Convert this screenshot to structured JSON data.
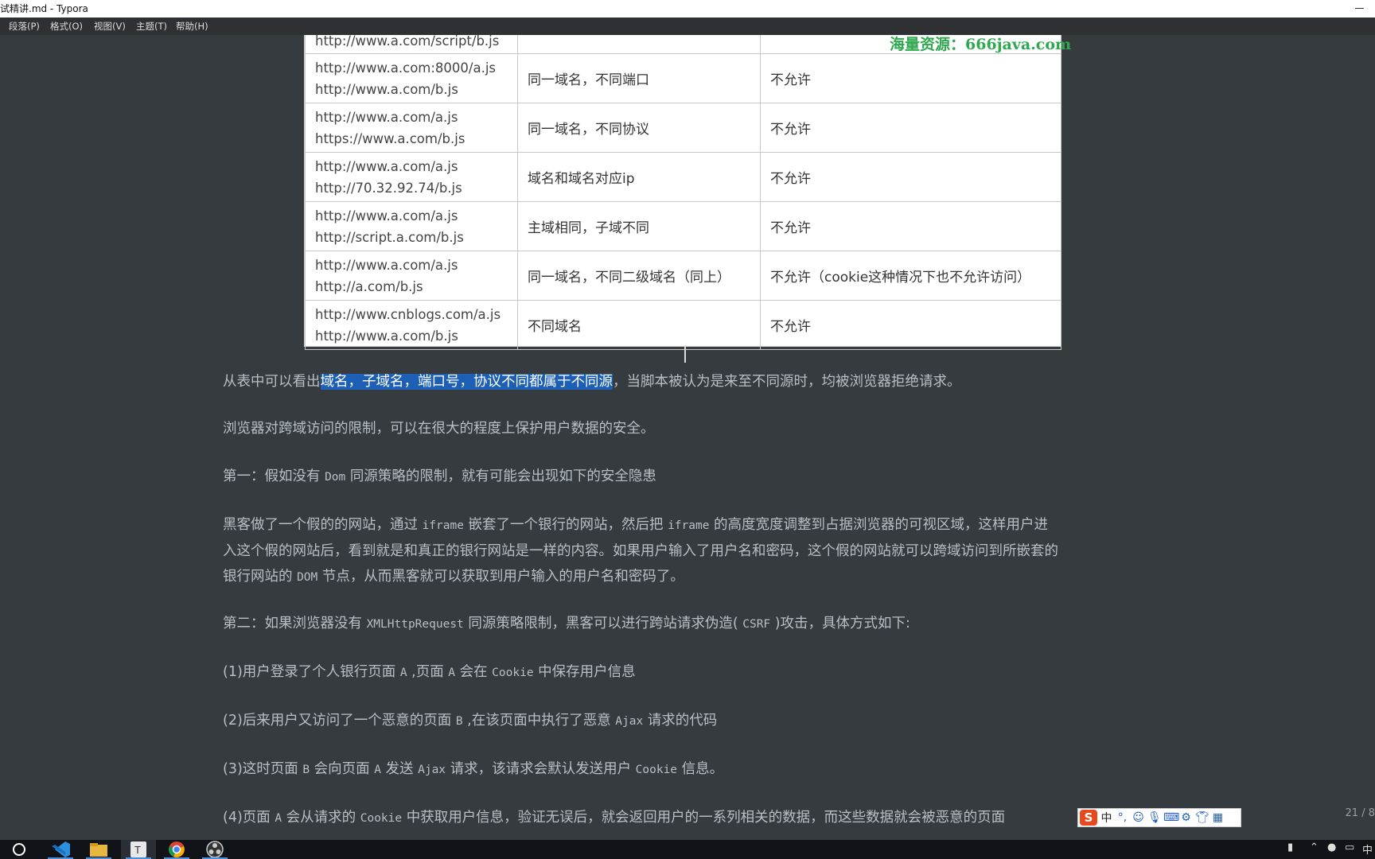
{
  "window": {
    "title": "试精讲.md - Typora"
  },
  "menu": [
    "段落(P)",
    "格式(O)",
    "视图(V)",
    "主题(T)",
    "帮助(H)"
  ],
  "watermark": "海量资源：666java.com",
  "table": {
    "rows": [
      {
        "url1": "http://www.a.com/script/b.js",
        "url2": "",
        "desc": "",
        "result": ""
      },
      {
        "url1": "http://www.a.com:8000/a.js",
        "url2": "http://www.a.com/b.js",
        "desc": "同一域名，不同端口",
        "result": "不允许"
      },
      {
        "url1": "http://www.a.com/a.js",
        "url2": "https://www.a.com/b.js",
        "desc": "同一域名，不同协议",
        "result": "不允许"
      },
      {
        "url1": "http://www.a.com/a.js",
        "url2": "http://70.32.92.74/b.js",
        "desc": "域名和域名对应ip",
        "result": "不允许"
      },
      {
        "url1": "http://www.a.com/a.js",
        "url2": "http://script.a.com/b.js",
        "desc": "主域相同，子域不同",
        "result": "不允许"
      },
      {
        "url1": "http://www.a.com/a.js",
        "url2": "http://a.com/b.js",
        "desc": "同一域名，不同二级域名（同上）",
        "result": "不允许（cookie这种情况下也不允许访问）"
      },
      {
        "url1": "http://www.cnblogs.com/a.js",
        "url2": "http://www.a.com/b.js",
        "desc": "不同域名",
        "result": "不允许"
      }
    ]
  },
  "paragraphs": {
    "p1_pre": "从表中可以看出",
    "p1_hl": "域名，子域名，端口号，协议不同都属于不同源",
    "p1_post": "，当脚本被认为是来至不同源时，均被浏览器拒绝请求。",
    "p2": "浏览器对跨域访问的限制，可以在很大的程度上保护用户数据的安全。",
    "p3_a": "第一：假如没有 ",
    "p3_code": "Dom",
    "p3_b": " 同源策略的限制，就有可能会出现如下的安全隐患",
    "p4_l1_a": "黑客做了一个假的的网站，通过 ",
    "p4_l1_code1": "iframe",
    "p4_l1_b": " 嵌套了一个银行的网站，然后把 ",
    "p4_l1_code2": "iframe",
    "p4_l1_c": " 的高度宽度调整到占据浏览器的可视区域，这样用户进",
    "p4_l2": "入这个假的网站后，看到就是和真正的银行网站是一样的内容。如果用户输入了用户名和密码，这个假的网站就可以跨域访问到所嵌套的",
    "p4_l3_a": "银行网站的 ",
    "p4_l3_code": "DOM",
    "p4_l3_b": " 节点，从而黑客就可以获取到用户输入的用户名和密码了。",
    "p5_a": "第二：如果浏览器没有 ",
    "p5_code1": "XMLHttpRequest",
    "p5_b": " 同源策略限制，黑客可以进行跨站请求伪造( ",
    "p5_code2": "CSRF",
    "p5_c": " )攻击，具体方式如下:",
    "p6_a": "(1)用户登录了个人银行页面 ",
    "p6_code1": "A",
    "p6_b": " ,页面 ",
    "p6_code2": "A",
    "p6_c": " 会在 ",
    "p6_code3": "Cookie",
    "p6_d": " 中保存用户信息",
    "p7_a": "(2)后来用户又访问了一个恶意的页面 ",
    "p7_code1": "B",
    "p7_b": " ,在该页面中执行了恶意 ",
    "p7_code2": "Ajax",
    "p7_c": " 请求的代码",
    "p8_a": "(3)这时页面 ",
    "p8_code1": "B",
    "p8_b": " 会向页面 ",
    "p8_code2": "A",
    "p8_c": " 发送 ",
    "p8_code3": "Ajax",
    "p8_d": " 请求，该请求会默认发送用户 ",
    "p8_code4": "Cookie",
    "p8_e": " 信息。",
    "p9_a": "(4)页面 ",
    "p9_code1": "A",
    "p9_b": " 会从请求的 ",
    "p9_code2": "Cookie",
    "p9_c": " 中获取用户信息，验证无误后，就会返回用户的一系列相关的数据，而这些数据就会被恶意的页面"
  },
  "status": {
    "page": "21 / 8"
  },
  "ime": {
    "logo": "S",
    "mode": "中"
  },
  "tray": {
    "lang": "中"
  },
  "colors": {
    "background": "#363b40",
    "text": "#b8bfc6",
    "selection": "#1d5fb4",
    "watermark": "#2fa84f"
  }
}
